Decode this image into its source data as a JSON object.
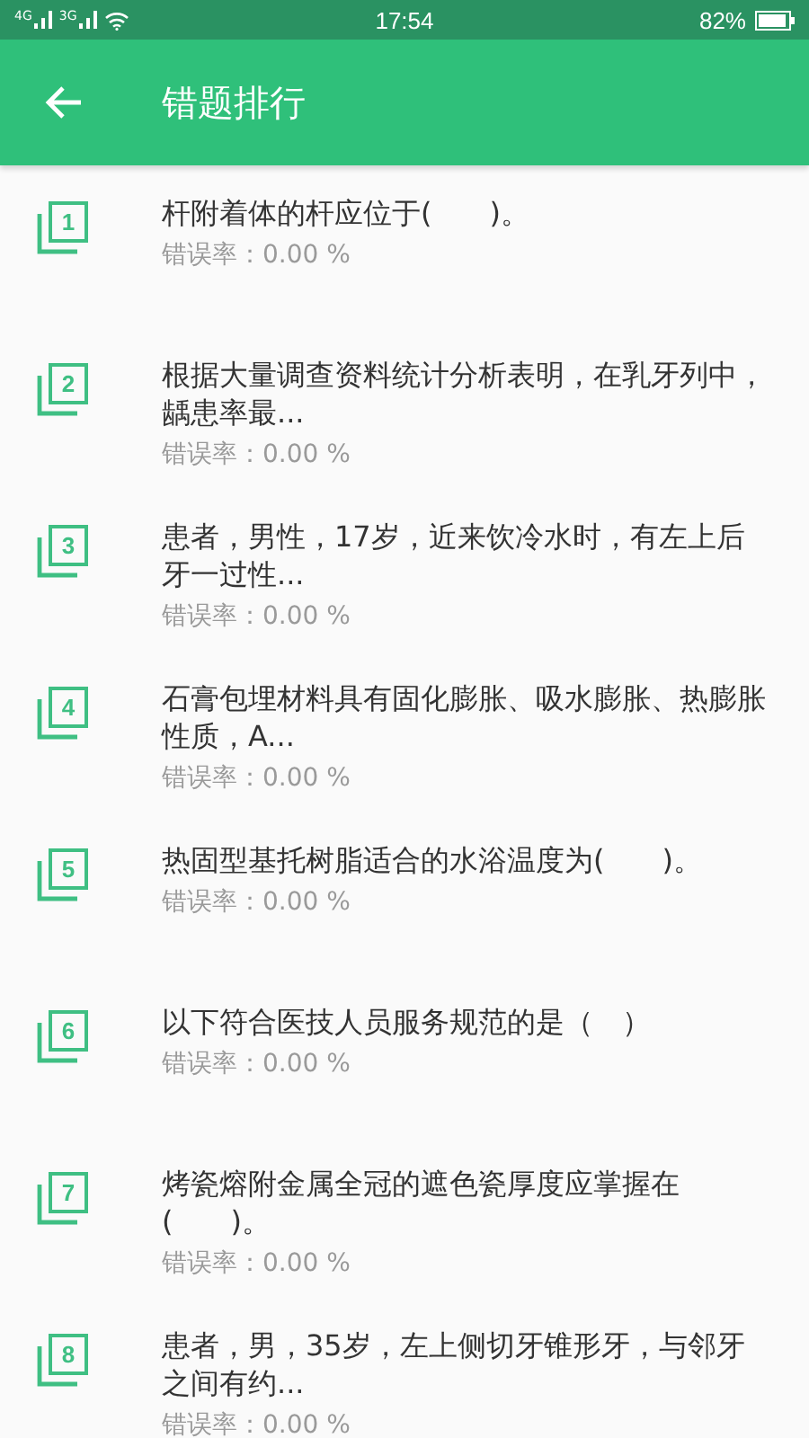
{
  "status_bar": {
    "time": "17:54",
    "battery": "82%",
    "network_labels": [
      "4G",
      "3G"
    ]
  },
  "app_bar": {
    "title": "错题排行"
  },
  "items": [
    {
      "number": "1",
      "question": "杆附着体的杆应位于(　　)。",
      "rate": "错误率：0.00 %"
    },
    {
      "number": "2",
      "question": "根据大量调查资料统计分析表明，在乳牙列中，龋患率最...",
      "rate": "错误率：0.00 %"
    },
    {
      "number": "3",
      "question": "患者，男性，17岁，近来饮冷水时，有左上后牙一过性...",
      "rate": "错误率：0.00 %"
    },
    {
      "number": "4",
      "question": "石膏包埋材料具有固化膨胀、吸水膨胀、热膨胀性质，A...",
      "rate": "错误率：0.00 %"
    },
    {
      "number": "5",
      "question": "热固型基托树脂适合的水浴温度为(　　)。",
      "rate": "错误率：0.00 %"
    },
    {
      "number": "6",
      "question": "以下符合医技人员服务规范的是（　）",
      "rate": "错误率：0.00 %"
    },
    {
      "number": "7",
      "question": "烤瓷熔附金属全冠的遮色瓷厚度应掌握在(　　)。",
      "rate": "错误率：0.00 %"
    },
    {
      "number": "8",
      "question": "患者，男，35岁，左上侧切牙锥形牙，与邻牙之间有约...",
      "rate": "错误率：0.00 %"
    }
  ]
}
